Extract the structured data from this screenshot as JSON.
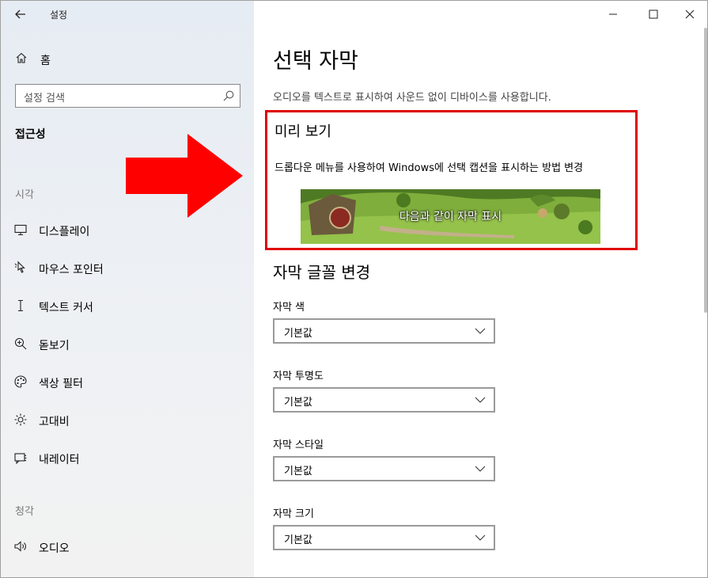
{
  "window": {
    "title": "설정"
  },
  "sidebar": {
    "home_label": "홈",
    "search_placeholder": "설정 검색",
    "section_title": "접근성",
    "groups": [
      {
        "label": "시각",
        "items": [
          {
            "label": "디스플레이",
            "icon": "monitor-icon"
          },
          {
            "label": "마우스 포인터",
            "icon": "mouse-pointer-icon"
          },
          {
            "label": "텍스트 커서",
            "icon": "text-cursor-icon"
          },
          {
            "label": "돋보기",
            "icon": "magnifier-icon"
          },
          {
            "label": "색상 필터",
            "icon": "palette-icon"
          },
          {
            "label": "고대비",
            "icon": "sun-icon"
          },
          {
            "label": "내레이터",
            "icon": "narrator-icon"
          }
        ]
      },
      {
        "label": "청각",
        "items": [
          {
            "label": "오디오",
            "icon": "speaker-icon"
          }
        ]
      }
    ]
  },
  "main": {
    "title": "선택 자막",
    "description": "오디오를 텍스트로 표시하여 사운드 없이 디바이스를 사용합니다.",
    "preview": {
      "heading": "미리 보기",
      "link": "드롭다운 메뉴를 사용하여 Windows에 선택 캡션을 표시하는 방법 변경",
      "caption": "다음과 같이 자막 표시"
    },
    "font_section": {
      "heading": "자막 글꼴 변경",
      "fields": [
        {
          "label": "자막 색",
          "value": "기본값"
        },
        {
          "label": "자막 투명도",
          "value": "기본값"
        },
        {
          "label": "자막 스타일",
          "value": "기본값"
        },
        {
          "label": "자막 크기",
          "value": "기본값"
        }
      ]
    }
  },
  "colors": {
    "highlight": "#e00000",
    "arrow": "#ff0000"
  }
}
